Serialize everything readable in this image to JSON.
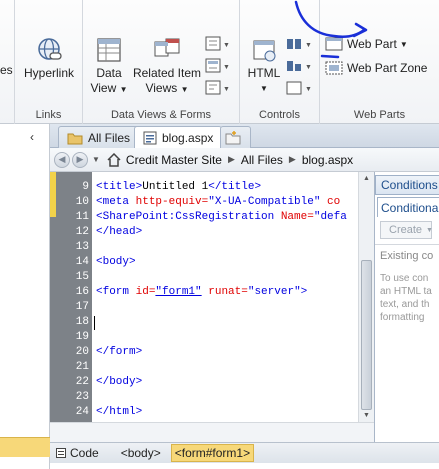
{
  "ribbon": {
    "partial_left": "es",
    "links_group": {
      "label": "Links",
      "hyperlink": "Hyperlink"
    },
    "dataviews_group": {
      "label": "Data Views & Forms",
      "data_view_1": "Data",
      "data_view_2": "View",
      "related_item_1": "Related Item",
      "related_item_2": "Views"
    },
    "controls_group": {
      "label": "Controls",
      "html": "HTML"
    },
    "webparts_group": {
      "label": "Web Parts",
      "web_part": "Web Part",
      "web_part_zone": "Web Part Zone"
    }
  },
  "tabs": [
    {
      "label": "All Files",
      "icon": "folder-icon",
      "active": false
    },
    {
      "label": "blog.aspx",
      "icon": "aspx-file-icon",
      "active": true
    }
  ],
  "breadcrumb": {
    "items": [
      "Credit Master Site",
      "All Files",
      "blog.aspx"
    ]
  },
  "editor": {
    "line_numbers": [
      "9",
      "10",
      "11",
      "12",
      "13",
      "14",
      "15",
      "16",
      "17",
      "18",
      "19",
      "20",
      "21",
      "22",
      "23",
      "24"
    ],
    "lines": {
      "l9": {
        "tag_open": "<title>",
        "text": "Untitled 1",
        "tag_close": "</title>"
      },
      "l10": {
        "tag": "<meta",
        "attr": " http-equiv=",
        "val": "\"X-UA-Compatible\"",
        "rest": " co"
      },
      "l11": {
        "tag": "<SharePoint:CssRegistration",
        "attr": " Name=",
        "val": "\"defa"
      },
      "l12": {
        "tag": "</head>"
      },
      "l14": {
        "tag": "<body>"
      },
      "l16": {
        "tag": "<form",
        "attr1": " id=",
        "val1": "\"form1\"",
        "attr2": " runat=",
        "val2": "\"server\"",
        "close": ">"
      },
      "l20": {
        "tag": "</form>"
      },
      "l22": {
        "tag": "</body>"
      },
      "l24": {
        "tag": "</html>"
      }
    }
  },
  "status": {
    "code_label": "Code",
    "crumbs": [
      "<body>",
      "<form#form1>"
    ]
  },
  "right_panel": {
    "header": "Conditions",
    "tab": "Conditional",
    "create_button": "Create",
    "existing_label": "Existing co",
    "help_lines": [
      "To use con",
      "an HTML ta",
      "text, and th",
      "formatting"
    ]
  },
  "colors": {
    "accent_blue": "#1e4e8c",
    "gutter": "#7d8288",
    "annotation_ink": "#1a2fd8",
    "selected_crumb": "#f7d879"
  }
}
